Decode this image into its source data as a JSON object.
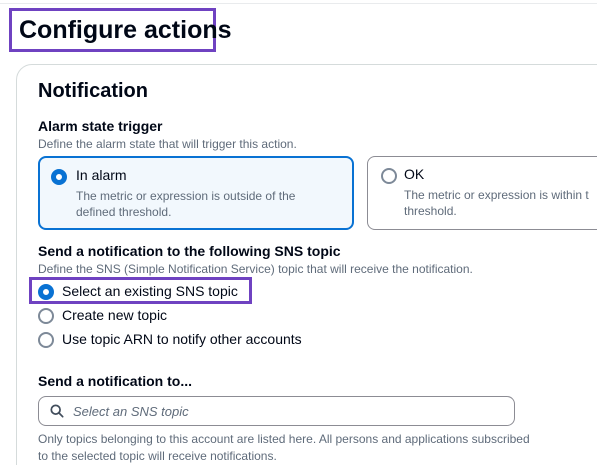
{
  "page": {
    "title": "Configure actions"
  },
  "notification": {
    "section_title": "Notification",
    "alarm_state": {
      "label": "Alarm state trigger",
      "description": "Define the alarm state that will trigger this action.",
      "options": [
        {
          "title": "In alarm",
          "description": "The metric or expression is outside of the defined threshold.",
          "selected": true
        },
        {
          "title": "OK",
          "description_line1": "The metric or expression is within t",
          "description_line2": "threshold.",
          "selected": false
        }
      ]
    },
    "sns_topic": {
      "label": "Send a notification to the following SNS topic",
      "description": "Define the SNS (Simple Notification Service) topic that will receive the notification.",
      "options": [
        {
          "label": "Select an existing SNS topic",
          "selected": true
        },
        {
          "label": "Create new topic",
          "selected": false
        },
        {
          "label": "Use topic ARN to notify other accounts",
          "selected": false
        }
      ]
    },
    "send_to": {
      "label": "Send a notification to...",
      "placeholder": "Select an SNS topic",
      "value": "",
      "hint": "Only topics belonging to this account are listed here. All persons and applications subscribed to the selected topic will receive notifications."
    }
  },
  "icons": {
    "search": "search-icon"
  },
  "colors": {
    "accent": "#0972d3",
    "highlight": "#6f42c1",
    "selected_tile_bg": "#f2f8fd"
  }
}
